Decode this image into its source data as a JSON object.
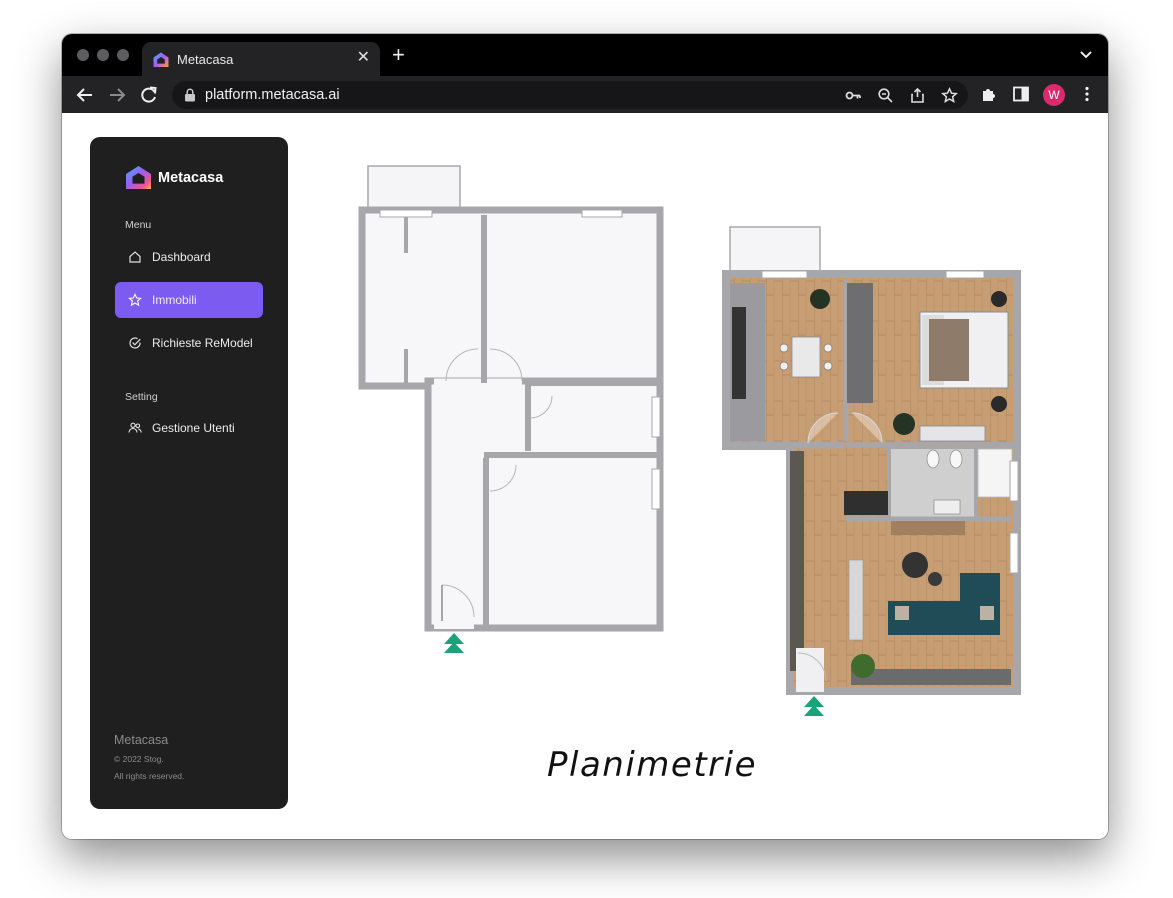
{
  "browser": {
    "tab_title": "Metacasa",
    "url": "platform.metacasa.ai",
    "profile_initial": "W"
  },
  "sidebar": {
    "brand": "Metacasa",
    "menu_label": "Menu",
    "items": [
      {
        "label": "Dashboard",
        "icon": "home-icon",
        "active": false
      },
      {
        "label": "Immobili",
        "icon": "star-icon",
        "active": true
      },
      {
        "label": "Richieste ReModel",
        "icon": "check-circle-icon",
        "active": false
      }
    ],
    "setting_label": "Setting",
    "setting_items": [
      {
        "label": "Gestione Utenti",
        "icon": "users-icon"
      }
    ],
    "footer": {
      "brand": "Metacasa",
      "copyright": "© 2022 Stog.",
      "rights": "All rights reserved."
    }
  },
  "main": {
    "caption": "Planimetrie"
  },
  "colors": {
    "accent": "#7c5cf0",
    "sidebar_bg": "#1f1f1f",
    "wall": "#a7a7ab",
    "floor_wood": "#c49a72",
    "entrance_arrow": "#1aa37a",
    "avatar": "#d92b6e"
  }
}
